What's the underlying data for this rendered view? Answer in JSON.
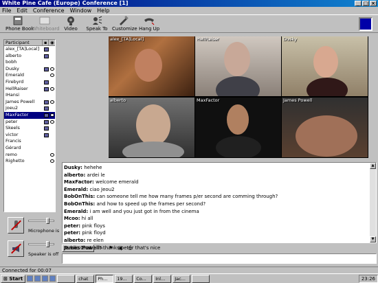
{
  "window": {
    "title": "White Pine Cafe (Europe) Conference [1]"
  },
  "menu": [
    "File",
    "Edit",
    "Conference",
    "Window",
    "Help"
  ],
  "toolbar": {
    "phone_book": "Phone Book",
    "whiteboard": "Whiteboard",
    "video": "Video",
    "speak_to": "Speak To",
    "customize": "Customize",
    "hang_up": "Hang Up"
  },
  "participants": {
    "header": "Participant",
    "rows": [
      {
        "name": "alex_[TA]Local]",
        "cam": true,
        "eye": false
      },
      {
        "name": "alberto",
        "cam": true,
        "eye": false
      },
      {
        "name": "bobh",
        "cam": false,
        "eye": false
      },
      {
        "name": "Dusky",
        "cam": true,
        "eye": true
      },
      {
        "name": "Emerald",
        "cam": false,
        "eye": true
      },
      {
        "name": "Firebyrd",
        "cam": true,
        "eye": false
      },
      {
        "name": "HellRaiser",
        "cam": true,
        "eye": true
      },
      {
        "name": "IHansi",
        "cam": false,
        "eye": false
      },
      {
        "name": "James Powell",
        "cam": true,
        "eye": true
      },
      {
        "name": "joeu2",
        "cam": true,
        "eye": false
      },
      {
        "name": "MaxFactor",
        "cam": true,
        "eye": true,
        "selected": true
      },
      {
        "name": "peter",
        "cam": true,
        "eye": true
      },
      {
        "name": "Skeels",
        "cam": true,
        "eye": false
      },
      {
        "name": "victor",
        "cam": true,
        "eye": false
      },
      {
        "name": "Francis",
        "cam": false,
        "eye": false
      },
      {
        "name": "Gérard",
        "cam": false,
        "eye": false
      },
      {
        "name": "remo",
        "cam": false,
        "eye": true
      },
      {
        "name": "Righetto",
        "cam": false,
        "eye": true
      }
    ]
  },
  "audio": {
    "microphone_label": "Microphone is",
    "speaker_label": "Speaker is off",
    "microphone_level": 0.85,
    "speaker_level": 0.85
  },
  "video": [
    {
      "label": "alex_[TA]Local]"
    },
    {
      "label": "HellRaiser"
    },
    {
      "label": "Dusky"
    },
    {
      "label": "alberto"
    },
    {
      "label": "MaxFactor"
    },
    {
      "label": "James Powell"
    }
  ],
  "chat": {
    "lines": [
      {
        "who": "Dusky:",
        "msg": " hehehe"
      },
      {
        "who": "alberto:",
        "msg": " ardei le"
      },
      {
        "who": "MaxFactor:",
        "msg": " welcome emerald"
      },
      {
        "who": "Emerald:",
        "msg": " ciao Jeou2"
      },
      {
        "who": "BobOnThis:",
        "msg": " can someone tell me how many frames p/er second are comming through?"
      },
      {
        "who": "BobOnThis:",
        "msg": " and how to speed up the frames per second?"
      },
      {
        "who": "Emerald:",
        "msg": " i am well and you just got in from the cinema"
      },
      {
        "who": "Mcoo:",
        "msg": " hi all"
      },
      {
        "who": "peter:",
        "msg": " pink floys"
      },
      {
        "who": "peter:",
        "msg": " pink floyd"
      },
      {
        "who": "alberto:",
        "msg": " re elen"
      },
      {
        "who": "James Powell:",
        "msg": " thanks peter that's nice"
      }
    ],
    "tab_label": "Public Chat",
    "input_value": ""
  },
  "status": "Connected for 00:07",
  "taskbar": {
    "start": "Start",
    "items": [
      "",
      "chat",
      "Ph...",
      "19...",
      "Co...",
      "Inl...",
      "Jac...",
      ""
    ],
    "clock": "23:26"
  },
  "colors": {
    "title": "#000080",
    "selection": "#000080",
    "flag": "#0000a8"
  }
}
